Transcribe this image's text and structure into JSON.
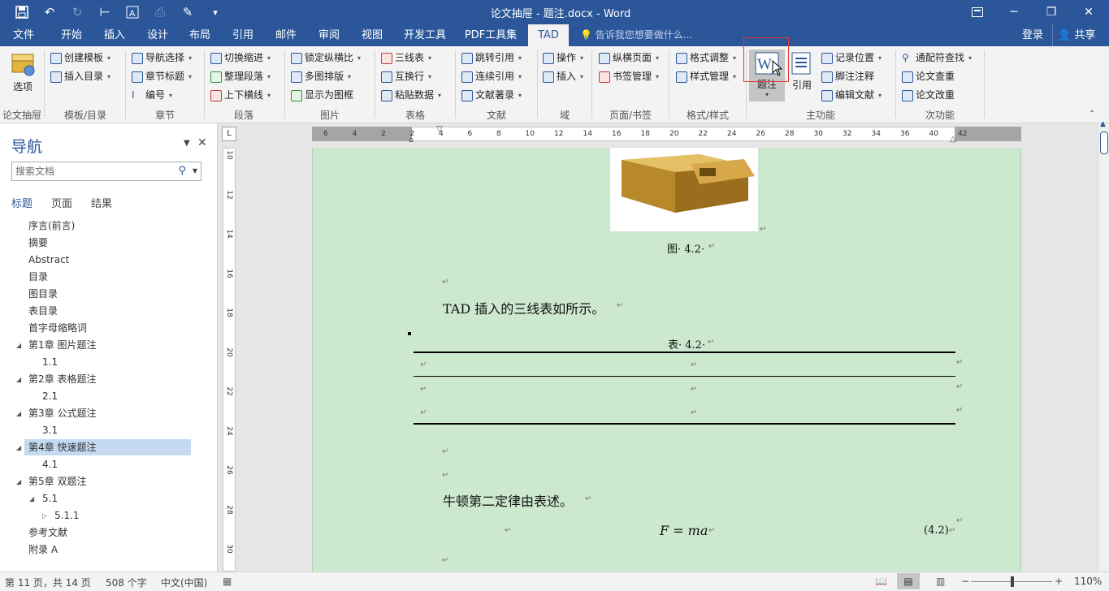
{
  "window": {
    "title": "论文抽屉 - 题注.docx - Word",
    "restore_tooltip": "",
    "controls": [
      "─",
      "❐",
      "✕"
    ]
  },
  "tabs": [
    "文件",
    "开始",
    "插入",
    "设计",
    "布局",
    "引用",
    "邮件",
    "审阅",
    "视图",
    "开发工具",
    "PDF工具集",
    "TAD"
  ],
  "active_tab": "TAD",
  "tellme": "告诉我您想要做什么...",
  "login": "登录",
  "share": "共享",
  "ribbon": {
    "options_label": "选项",
    "groups": [
      "论文抽屉",
      "模板/目录",
      "章节",
      "段落",
      "图片",
      "表格",
      "文献",
      "域",
      "页面/书签",
      "格式/样式",
      "主功能",
      "次功能"
    ],
    "buttons": {
      "create_template": "创建模板",
      "insert_toc": "插入目录",
      "nav_select": "导航选择",
      "chapter_title": "章节标题",
      "numbering": "编号",
      "toggle_indent": "切换缩进",
      "arrange_para": "整理段落",
      "updown_lines": "上下横线",
      "lock_ratio": "锁定纵横比",
      "multi_layout": "多图排版",
      "show_frame": "显示为图框",
      "three_line": "三线表",
      "swap_rows": "互换行",
      "paste_data": "粘贴数据",
      "jump_ref": "跳转引用",
      "cont_ref": "连续引用",
      "bib": "文献著录",
      "operate": "操作",
      "insert": "插入",
      "land_page": "纵横页面",
      "bookmark": "书签管理",
      "fmt_adjust": "格式调整",
      "style_mgmt": "样式管理",
      "caption": "题注",
      "cite": "引用",
      "record_pos": "记录位置",
      "footnote": "脚注注释",
      "edit_lit": "编辑文献",
      "wildcard": "通配符查找",
      "check_paper": "论文查重",
      "revise_paper": "论文改重"
    }
  },
  "nav": {
    "title": "导航",
    "search_placeholder": "搜索文档",
    "tabs": [
      "标题",
      "页面",
      "结果"
    ],
    "items": [
      {
        "label": "序言(前言)",
        "level": 0
      },
      {
        "label": "摘要",
        "level": 0
      },
      {
        "label": "Abstract",
        "level": 0
      },
      {
        "label": "目录",
        "level": 0
      },
      {
        "label": "图目录",
        "level": 0
      },
      {
        "label": "表目录",
        "level": 0
      },
      {
        "label": "首字母缩略词",
        "level": 0
      },
      {
        "label": "第1章 图片题注",
        "level": 0
      },
      {
        "label": "1.1",
        "level": 1
      },
      {
        "label": "第2章 表格题注",
        "level": 0
      },
      {
        "label": "2.1",
        "level": 1
      },
      {
        "label": "第3章 公式题注",
        "level": 0
      },
      {
        "label": "3.1",
        "level": 1
      },
      {
        "label": "第4章 快速题注",
        "level": 0
      },
      {
        "label": "4.1",
        "level": 1
      },
      {
        "label": "第5章 双题注",
        "level": 0
      },
      {
        "label": "5.1",
        "level": 1
      },
      {
        "label": "5.1.1",
        "level": 2
      },
      {
        "label": "参考文献",
        "level": 0
      },
      {
        "label": "附录 A",
        "level": 0
      }
    ],
    "selected": "第4章 快速题注"
  },
  "document": {
    "fig_caption": "图· 4.2· ",
    "para1": "TAD 插入的三线表如所示。",
    "table_caption": "表· 4.2· ",
    "para2": "牛顿第二定律由表述。",
    "equation": "F = ma",
    "eq_number": "(4.2)",
    "para_mark": "↵",
    "ruler_h": [
      "6",
      "4",
      "2",
      "2",
      "4",
      "6",
      "8",
      "10",
      "12",
      "14",
      "16",
      "18",
      "20",
      "22",
      "24",
      "26",
      "28",
      "30",
      "32",
      "34",
      "36",
      "40",
      "42"
    ],
    "ruler_v": [
      "10",
      "12",
      "14",
      "16",
      "18",
      "20",
      "22",
      "24",
      "26",
      "28",
      "30"
    ]
  },
  "status": {
    "page": "第 11 页，共 14 页",
    "words": "508 个字",
    "lang": "中文(中国)",
    "zoom": "110%"
  },
  "colors": {
    "brand": "#2b579a",
    "page_bg": "#cce8cf",
    "highlight": "#e03a3a"
  }
}
